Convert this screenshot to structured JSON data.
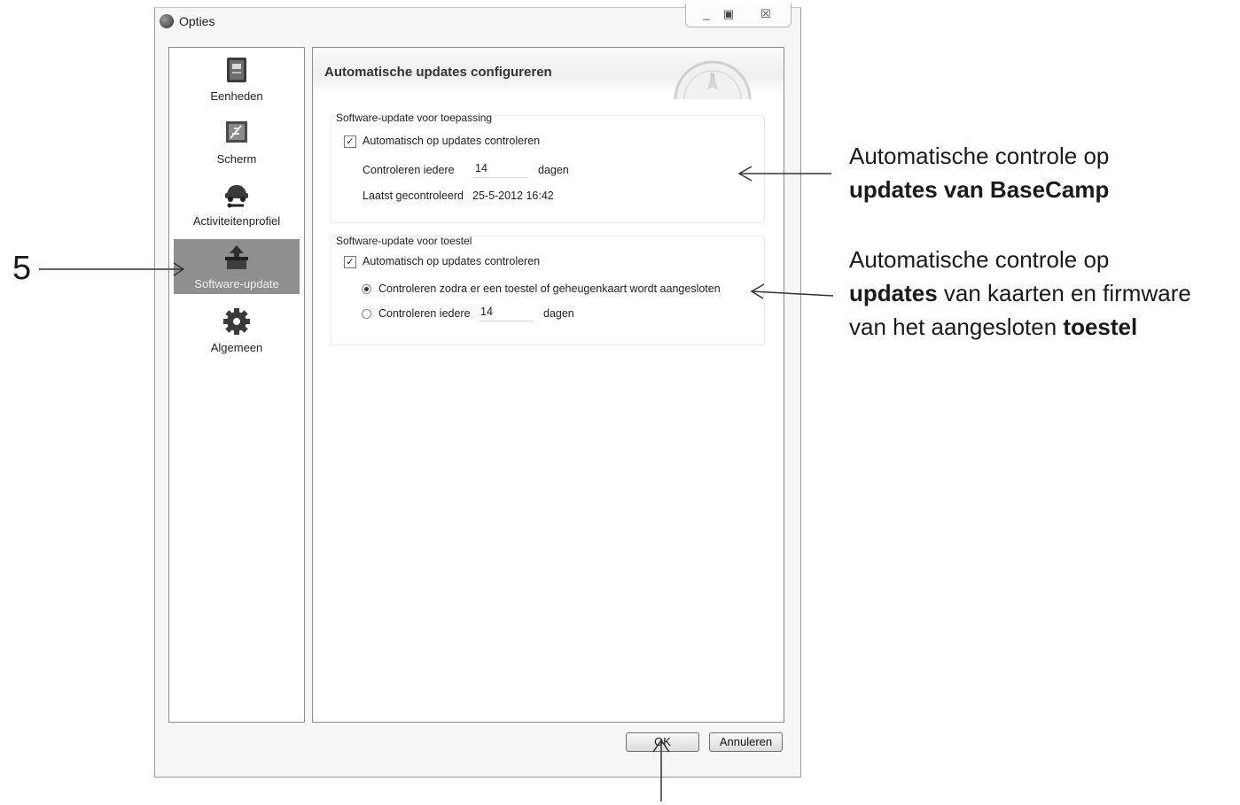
{
  "window": {
    "title": "Opties",
    "buttons": {
      "minimize": "_",
      "maximize": "▣",
      "close": "☒"
    }
  },
  "sidebar": {
    "items": [
      {
        "label": "Eenheden",
        "icon": "units-book-icon",
        "selected": false
      },
      {
        "label": "Scherm",
        "icon": "display-settings-icon",
        "selected": false
      },
      {
        "label": "Activiteitenprofiel",
        "icon": "car-wrench-icon",
        "selected": false
      },
      {
        "label": "Software-update",
        "icon": "software-update-box-icon",
        "selected": true
      },
      {
        "label": "Algemeen",
        "icon": "gear-icon",
        "selected": false
      }
    ]
  },
  "content": {
    "header": {
      "title": "Automatische updates configureren",
      "icon": "compass-icon"
    },
    "app_update": {
      "label": "Software-update voor toepassing",
      "auto_check_label": "Automatisch op updates controleren",
      "auto_check": true,
      "interval_label": "Controleren iedere",
      "interval_value": "14",
      "interval_unit": "dagen",
      "last_checked_label": "Laatst gecontroleerd",
      "last_checked_value": "25-5-2012 16:42"
    },
    "device_update": {
      "label": "Software-update voor toestel",
      "auto_check_label": "Automatisch op updates controleren",
      "auto_check": true,
      "option_connect_label": "Controleren zodra er een toestel of geheugenkaart wordt aangesloten",
      "option_connect_selected": true,
      "option_interval_label": "Controleren iedere",
      "option_interval_value": "14",
      "option_interval_unit": "dagen"
    }
  },
  "footer": {
    "ok_label": "OK",
    "cancel_label": "Annuleren"
  },
  "annotations": {
    "marker": "5",
    "app_note_line1": "Automatische controle op",
    "app_note_line2": "updates van BaseCamp",
    "dev_note_line1": "Automatische controle op",
    "dev_note_l2_bold": "updates",
    "dev_note_l2_rest": " van kaarten en firmware",
    "dev_note_l3_rest": "van het aangesloten ",
    "dev_note_l3_bold": "toestel"
  }
}
